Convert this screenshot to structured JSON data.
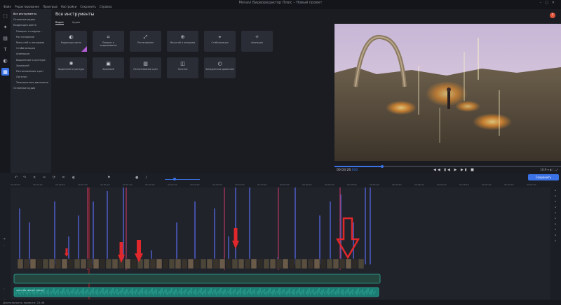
{
  "window": {
    "title": "Movavi Видеоредактор Плюс – Новый проект"
  },
  "menu": [
    "Файл",
    "Редактирование",
    "Проигрыв",
    "Настройки",
    "Сохранить",
    "Справка"
  ],
  "rail": [
    {
      "icon": "import-icon",
      "glyph": "⬚"
    },
    {
      "icon": "magic-icon",
      "glyph": "✦"
    },
    {
      "icon": "transitions-icon",
      "glyph": "▤"
    },
    {
      "icon": "titles-icon",
      "glyph": "T"
    },
    {
      "icon": "stickers-icon",
      "glyph": "◐"
    },
    {
      "icon": "tools-icon",
      "glyph": "▦"
    }
  ],
  "tree": [
    {
      "label": "Все инструменты",
      "level": 0,
      "selected": true
    },
    {
      "label": "Основные видео",
      "level": 0
    },
    {
      "label": "Коррекция цвета",
      "level": 0
    },
    {
      "label": "Поворот и кадрир...",
      "level": 1
    },
    {
      "label": "Растягивание",
      "level": 1
    },
    {
      "label": "Масштаб и панорама",
      "level": 1
    },
    {
      "label": "Стабилизация",
      "level": 1
    },
    {
      "label": "Анимация",
      "level": 1
    },
    {
      "label": "Выделение и цензура",
      "level": 1
    },
    {
      "label": "Хромакей",
      "level": 1
    },
    {
      "label": "Распознавание сцен",
      "level": 1
    },
    {
      "label": "Логотип",
      "level": 1
    },
    {
      "label": "Замедленное движение",
      "level": 1
    },
    {
      "label": "Основные аудио",
      "level": 0
    }
  ],
  "main": {
    "title": "Все инструменты",
    "tabs": [
      {
        "label": "Видео",
        "active": true
      },
      {
        "label": "Аудио",
        "active": false
      }
    ],
    "tools": [
      {
        "label": "Коррекция цвета",
        "icon": "color-correction-icon",
        "glyph": "◐",
        "pro": true
      },
      {
        "label": "Поворот и кадрирование",
        "icon": "crop-icon",
        "glyph": "⌗"
      },
      {
        "label": "Растягивание",
        "icon": "stretch-icon",
        "glyph": "⤢"
      },
      {
        "label": "Масштаб и панорама",
        "icon": "zoom-pan-icon",
        "glyph": "⊕"
      },
      {
        "label": "Стабилизация",
        "icon": "stabilization-icon",
        "glyph": "⌖"
      },
      {
        "label": "Анимация",
        "icon": "animation-icon",
        "glyph": "✧"
      },
      {
        "label": "Выделение и цензура",
        "icon": "highlight-icon",
        "glyph": "✺"
      },
      {
        "label": "Хромакей",
        "icon": "chroma-key-icon",
        "glyph": "▣"
      },
      {
        "label": "Распознавание сцен",
        "icon": "scene-detect-icon",
        "glyph": "▥"
      },
      {
        "label": "Логотип",
        "icon": "logo-icon",
        "glyph": "◫"
      },
      {
        "label": "Замедленное движение",
        "icon": "slow-motion-icon",
        "glyph": "◴"
      }
    ]
  },
  "preview": {
    "timecode": "00:03:26",
    "timecode_ms": ".000",
    "progress": 0.21,
    "controls": "◀◀ ▮◀ ▶ ▶▮ ■",
    "right": "16:9 ▾  ◐  ⛶  ⤢"
  },
  "timeline": {
    "save_label": "Сохранить",
    "ruler": [
      "00:00:00",
      "00:00:20",
      "00:00:40",
      "00:01:00",
      "00:01:20",
      "00:01:40",
      "00:02:00",
      "00:02:20",
      "00:02:40",
      "00:03:00",
      "00:03:20",
      "00:03:40",
      "00:04:00",
      "00:04:20",
      "00:04:40",
      "00:05:00",
      "00:05:20",
      "00:05:40",
      "00:06:00",
      "00:06:20",
      "00:06:40",
      "00:07:00",
      "00:07:20",
      "00:07:40"
    ],
    "audio_label": "Audio file capture 1 (final)"
  },
  "status": {
    "text": "Длительность проекта: 25:48"
  },
  "colors": {
    "accent": "#3b72e6",
    "audio": "#1c7e73",
    "arrow": "#e0272b",
    "marker": "#d63b6e"
  }
}
